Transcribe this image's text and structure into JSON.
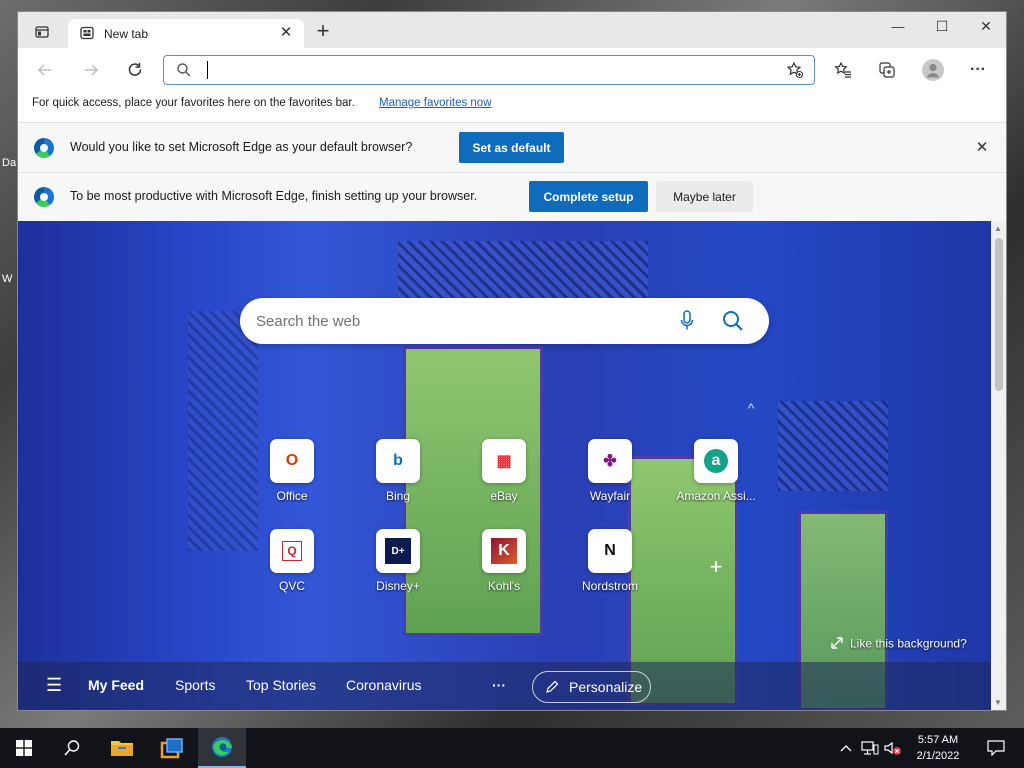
{
  "desktop": {
    "fragment_1": "Da",
    "fragment_2": "W"
  },
  "window": {
    "controls": {
      "minimize": "—",
      "maximize": "☐",
      "close": "✕"
    }
  },
  "tab": {
    "title": "New tab",
    "close": "✕",
    "new_tab": "+"
  },
  "toolbar": {
    "address_value": "",
    "more": "···"
  },
  "favorites_bar": {
    "message": "For quick access, place your favorites here on the favorites bar.",
    "link": "Manage favorites now"
  },
  "infobar_default": {
    "text": "Would you like to set Microsoft Edge as your default browser?",
    "button": "Set as default",
    "close": "✕"
  },
  "infobar_setup": {
    "text": "To be most productive with Microsoft Edge, finish setting up your browser.",
    "primary_button": "Complete setup",
    "secondary_button": "Maybe later"
  },
  "newtab": {
    "search_placeholder": "Search the web",
    "collapse": "^",
    "add_site": "+",
    "quick_links": [
      {
        "label": "Office",
        "glyph": "O",
        "color": "#d83b01"
      },
      {
        "label": "Bing",
        "glyph": "b",
        "color": "#0f6cbd"
      },
      {
        "label": "eBay",
        "glyph": "▦",
        "color": "#e53238"
      },
      {
        "label": "Wayfair",
        "glyph": "✤",
        "color": "#7f187f"
      },
      {
        "label": "Amazon Assi...",
        "glyph": "a",
        "color": "#12a38a"
      },
      {
        "label": "QVC",
        "glyph": "Q",
        "color": "#c4262e"
      },
      {
        "label": "Disney+",
        "glyph": "D+",
        "color": "#0b1a4f"
      },
      {
        "label": "Kohl's",
        "glyph": "K",
        "color": "#8b1538"
      },
      {
        "label": "Nordstrom",
        "glyph": "N",
        "color": "#111111"
      }
    ],
    "like_background": "Like this background?",
    "feed": {
      "menu": "☰",
      "items": [
        "My Feed",
        "Sports",
        "Top Stories",
        "Coronavirus"
      ],
      "more": "···",
      "personalize": "Personalize"
    }
  },
  "taskbar": {
    "time": "5:57 AM",
    "date": "2/1/2022"
  }
}
